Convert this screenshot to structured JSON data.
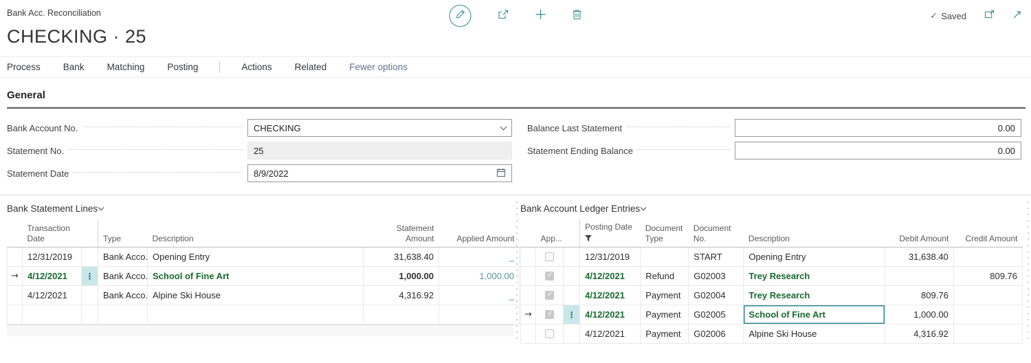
{
  "header": {
    "breadcrumb": "Bank Acc. Reconciliation",
    "title": "CHECKING · 25",
    "saved": "Saved"
  },
  "icons": {
    "edit": "pencil-in-circle",
    "share": "share-box-arrow",
    "new": "plus",
    "delete": "trash",
    "saved_check": "checkmark",
    "open_window": "popout-window",
    "resize": "diagonal-arrow",
    "combo_chevron": "chevron-down",
    "calendar": "calendar",
    "filter": "funnel",
    "row_menu": "vertical-ellipsis",
    "selected_row": "right-arrow"
  },
  "colors": {
    "accent_teal": "#2f8b92",
    "matched_green": "#176a2e",
    "applied_link": "#55949e",
    "disabled_field_bg": "#efefef"
  },
  "action_bar": {
    "process": "Process",
    "bank": "Bank",
    "matching": "Matching",
    "posting": "Posting",
    "actions": "Actions",
    "related": "Related",
    "fewer_options": "Fewer options"
  },
  "general": {
    "section_title": "General",
    "fields": {
      "bank_account_no": {
        "label": "Bank Account No.",
        "value": "CHECKING"
      },
      "statement_no": {
        "label": "Statement No.",
        "value": "25"
      },
      "statement_date": {
        "label": "Statement Date",
        "value": "8/9/2022"
      },
      "balance_last_statement": {
        "label": "Balance Last Statement",
        "value": "0.00"
      },
      "statement_ending_balance": {
        "label": "Statement Ending Balance",
        "value": "0.00"
      }
    }
  },
  "statement_lines": {
    "caption": "Bank Statement Lines",
    "headers": {
      "transaction_date": "Transaction Date",
      "type": "Type",
      "description": "Description",
      "statement_amount": "Statement Amount",
      "applied_amount": "Applied Amount"
    },
    "rows": [
      {
        "transaction_date": "12/31/2019",
        "type": "Bank Acco...",
        "description": "Opening Entry",
        "statement_amount": "31,638.40",
        "applied_amount": "_"
      },
      {
        "transaction_date": "4/12/2021",
        "type": "Bank Acco...",
        "description": "School of Fine Art",
        "statement_amount": "1,000.00",
        "applied_amount": "1,000.00"
      },
      {
        "transaction_date": "4/12/2021",
        "type": "Bank Acco...",
        "description": "Alpine Ski House",
        "statement_amount": "4,316.92",
        "applied_amount": "_"
      },
      {
        "transaction_date": "",
        "type": "",
        "description": "",
        "statement_amount": "",
        "applied_amount": ""
      }
    ]
  },
  "ledger_entries": {
    "caption": "Bank Account Ledger Entries",
    "headers": {
      "applied": "App...",
      "posting_date": "Posting Date",
      "document_type": "Document Type",
      "document_no": "Document No.",
      "description": "Description",
      "debit_amount": "Debit Amount",
      "credit_amount": "Credit Amount"
    },
    "rows": [
      {
        "applied": false,
        "posting_date": "12/31/2019",
        "document_type": "",
        "document_no": "START",
        "description": "Opening Entry",
        "debit_amount": "31,638.40",
        "credit_amount": ""
      },
      {
        "applied": true,
        "posting_date": "4/12/2021",
        "document_type": "Refund",
        "document_no": "G02003",
        "description": "Trey Research",
        "debit_amount": "",
        "credit_amount": "809.76"
      },
      {
        "applied": true,
        "posting_date": "4/12/2021",
        "document_type": "Payment",
        "document_no": "G02004",
        "description": "Trey Research",
        "debit_amount": "809.76",
        "credit_amount": ""
      },
      {
        "applied": true,
        "posting_date": "4/12/2021",
        "document_type": "Payment",
        "document_no": "G02005",
        "description": "School of Fine Art",
        "debit_amount": "1,000.00",
        "credit_amount": ""
      },
      {
        "applied": false,
        "posting_date": "4/12/2021",
        "document_type": "Payment",
        "document_no": "G02006",
        "description": "Alpine Ski House",
        "debit_amount": "4,316.92",
        "credit_amount": ""
      }
    ]
  }
}
